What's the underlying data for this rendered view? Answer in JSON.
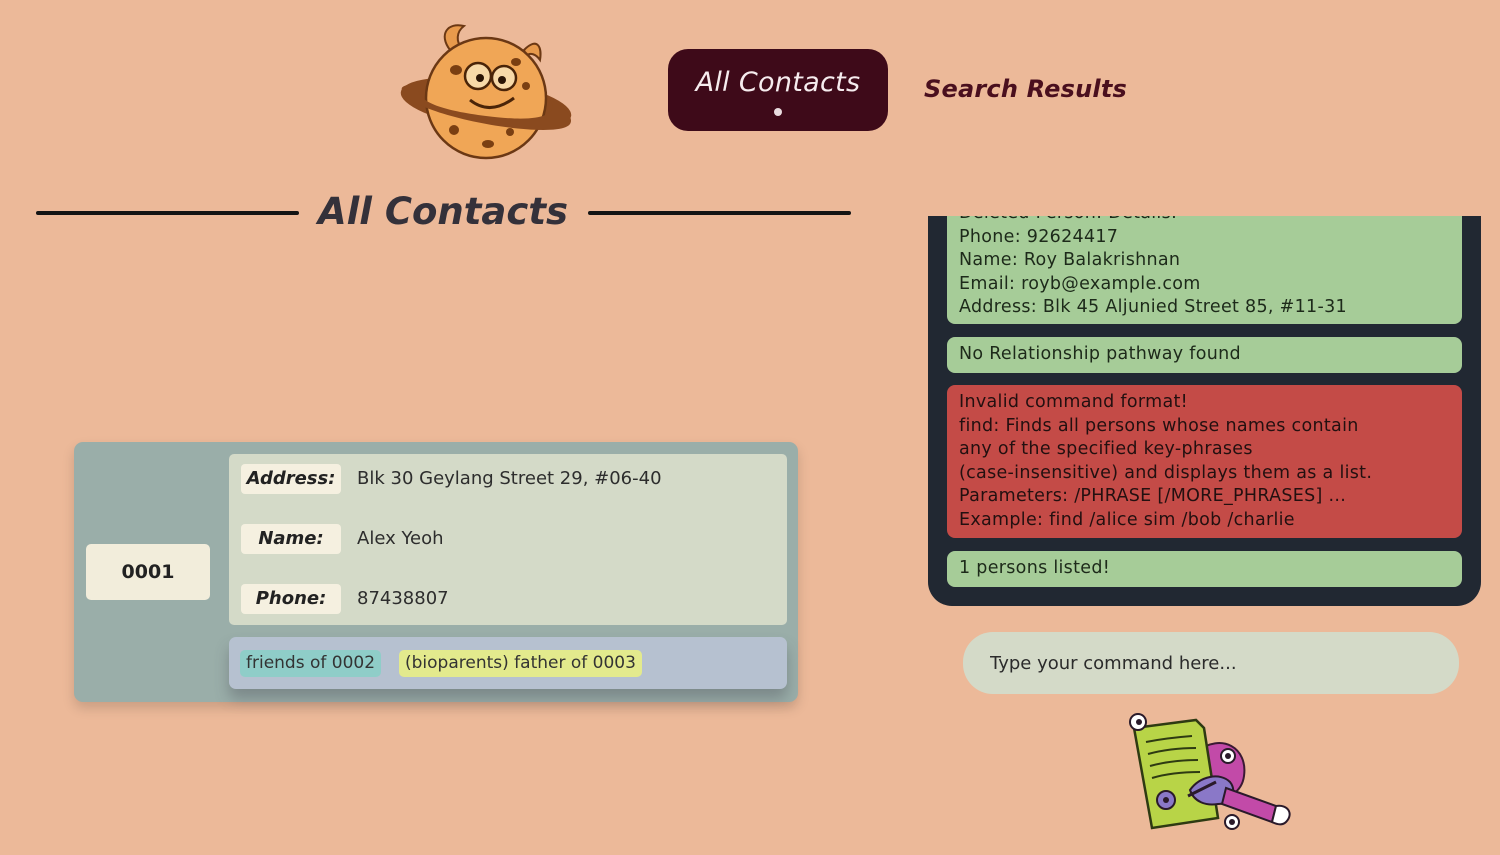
{
  "nav": {
    "active_tab": "All Contacts",
    "inactive_tab": "Search Results",
    "logo_icon": "monster-cookie-planet-logo"
  },
  "section": {
    "title": "All Contacts"
  },
  "contact": {
    "id": "0001",
    "address_label": "Address:",
    "address": "Blk 30 Geylang Street 29, #06-40",
    "name_label": "Name:",
    "name": "Alex Yeoh",
    "phone_label": "Phone:",
    "phone": "87438807",
    "relations": [
      "friends of 0002",
      "(bioparents) father of 0003"
    ]
  },
  "results": {
    "messages": [
      {
        "status": "success",
        "lines": [
          "Deleted Person: Details:",
          "Phone: 92624417",
          "Name: Roy Balakrishnan",
          "Email: royb@example.com",
          "Address: Blk 45 Aljunied Street 85, #11-31"
        ]
      },
      {
        "status": "success",
        "lines": [
          "No Relationship pathway found"
        ]
      },
      {
        "status": "error",
        "lines": [
          "Invalid command format!",
          "find: Finds all persons whose names contain",
          "any of the specified key-phrases",
          "(case-insensitive) and displays them as a list.",
          "Parameters: /PHRASE [/MORE_PHRASES] ...",
          "Example: find /alice sim /bob /charlie"
        ]
      },
      {
        "status": "success",
        "lines": [
          "1 persons listed!"
        ]
      }
    ]
  },
  "command": {
    "placeholder": "Type your command here..."
  },
  "colors": {
    "background": "#ecb999",
    "tab_active": "#3e0a19",
    "panel": "#212832",
    "success": "#a6cc98",
    "error": "#c44b47"
  },
  "icons": {
    "mascot": "monster-writing-document-mascot"
  }
}
